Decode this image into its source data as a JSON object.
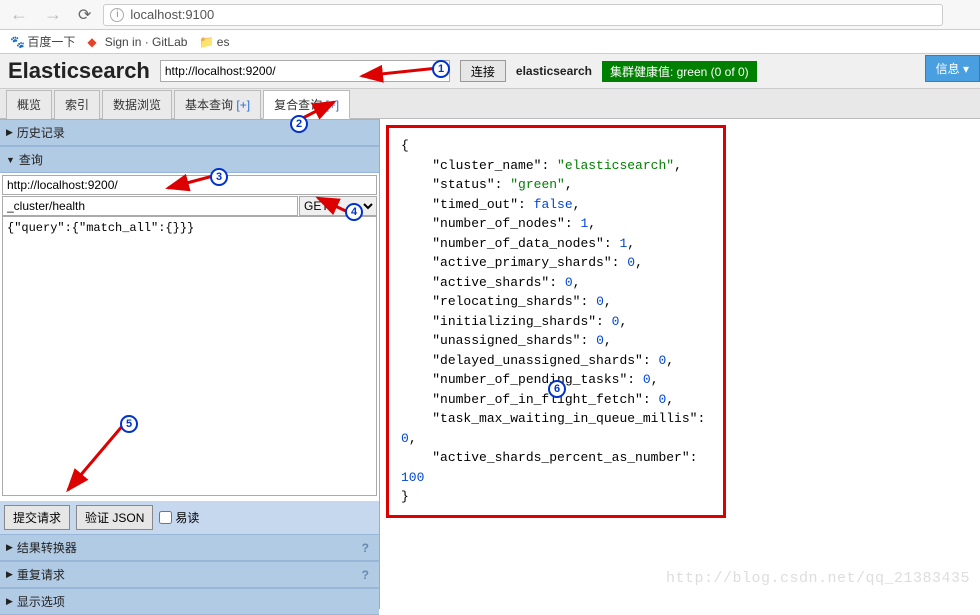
{
  "browser": {
    "url": "localhost:9100",
    "bookmarks": [
      {
        "label": "百度一下",
        "icon": "paw"
      },
      {
        "label": "Sign in · GitLab",
        "icon": "gitlab"
      },
      {
        "label": "es",
        "icon": "folder"
      }
    ]
  },
  "header": {
    "title": "Elasticsearch",
    "conn_url": "http://localhost:9200/",
    "connect_btn": "连接",
    "cluster_name": "elasticsearch",
    "health_label": "集群健康值: green (0 of 0)",
    "info_btn": "信息 ▾"
  },
  "tabs": [
    {
      "label": "概览",
      "active": false
    },
    {
      "label": "索引",
      "active": false
    },
    {
      "label": "数据浏览",
      "active": false
    },
    {
      "label": "基本查询",
      "plus": "[+]",
      "active": false
    },
    {
      "label": "复合查询",
      "plus": "[+]",
      "active": true
    }
  ],
  "left": {
    "history_hdr": "历史记录",
    "query_hdr": "查询",
    "base_url": "http://localhost:9200/",
    "path": "_cluster/health",
    "method": "GET",
    "body": "{\"query\":{\"match_all\":{}}}",
    "submit_btn": "提交请求",
    "validate_btn": "验证 JSON",
    "pretty_label": "易读",
    "transformer_hdr": "结果转换器",
    "repeat_hdr": "重复请求",
    "display_hdr": "显示选项"
  },
  "result": {
    "cluster_name": "elasticsearch",
    "status": "green",
    "timed_out": false,
    "number_of_nodes": 1,
    "number_of_data_nodes": 1,
    "active_primary_shards": 0,
    "active_shards": 0,
    "relocating_shards": 0,
    "initializing_shards": 0,
    "unassigned_shards": 0,
    "delayed_unassigned_shards": 0,
    "number_of_pending_tasks": 0,
    "number_of_in_flight_fetch": 0,
    "task_max_waiting_in_queue_millis": 0,
    "active_shards_percent_as_number": 100
  },
  "watermark": "http://blog.csdn.net/qq_21383435",
  "annotations": [
    "1",
    "2",
    "3",
    "4",
    "5",
    "6"
  ]
}
